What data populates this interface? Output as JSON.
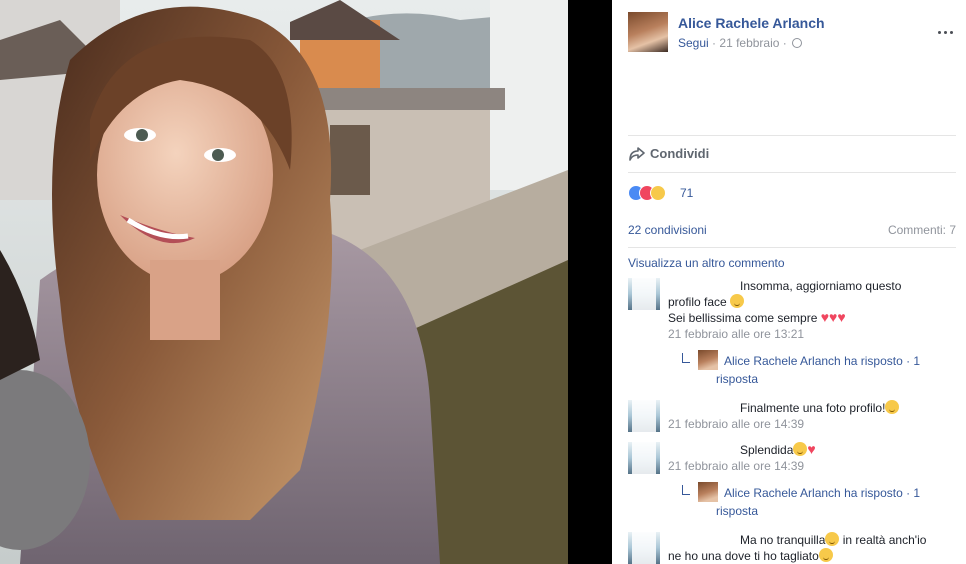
{
  "post": {
    "author": "Alice Rachele Arlanch",
    "follow_label": "Segui",
    "date": "21 febbraio",
    "separator": "·",
    "share_label": "Condividi",
    "reaction_count": "71",
    "shares": "22 condivisioni",
    "comments": "Commenti: 7",
    "view_more": "Visualizza un altro commento"
  },
  "comments": [
    {
      "text_line1": "Insomma, aggiorniamo questo",
      "text_line2": "profilo face",
      "text_line3": "Sei bellissima come sempre",
      "time": "21 febbraio alle ore 13:21",
      "reply_text": "Alice Rachele Arlanch ha risposto · 1",
      "reply_text2": "risposta"
    },
    {
      "text": "Finalmente una foto profilo!",
      "time": "21 febbraio alle ore 14:39"
    },
    {
      "text": "Splendida",
      "time": "21 febbraio alle ore 14:39",
      "reply_text": "Alice Rachele Arlanch ha risposto · 1",
      "reply_text2": "risposta"
    },
    {
      "text_line1": "Ma no tranquilla",
      "text_line1b": "in realtà anch'io",
      "text_line2": "ne ho una dove ti ho tagliato"
    }
  ],
  "icons": {
    "share": "share-arrow-icon",
    "more": "more-options-icon",
    "privacy": "globe-icon"
  },
  "colors": {
    "link": "#365899",
    "muted": "#90949c",
    "like": "#4a8af4",
    "love": "#f0465f",
    "wow": "#f7c94a"
  }
}
